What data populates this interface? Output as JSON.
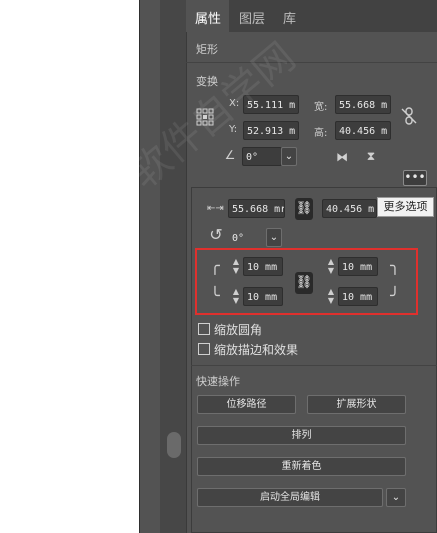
{
  "tabs": [
    {
      "label": "属性"
    },
    {
      "label": "图层"
    },
    {
      "label": "库"
    }
  ],
  "shape_title": "矩形",
  "transform": {
    "section_title": "变换",
    "x_label": "X:",
    "x_value": "55.111 m",
    "y_label": "Y:",
    "y_value": "52.913 m",
    "w_label": "宽:",
    "w_value": "55.668 m",
    "h_label": "高:",
    "h_value": "40.456 m",
    "angle_value": "0°"
  },
  "more_options": {
    "tooltip": "更多选项",
    "width_value": "55.668 mr",
    "height_value": "40.456 m",
    "rotate_value": "0°",
    "corner_tl": "10 mm",
    "corner_tr": "10 mm",
    "corner_bl": "10 mm",
    "corner_br": "10 mm",
    "scale_corners_label": "缩放圆角",
    "scale_strokes_label": "缩放描边和效果"
  },
  "quick_actions": {
    "title": "快速操作",
    "offset_path": "位移路径",
    "expand_shape": "扩展形状",
    "arrange": "排列",
    "recolor": "重新着色",
    "global_edit": "启动全局编辑"
  },
  "watermark_text": "软件自学网",
  "colors": {
    "panel_bg": "#535353",
    "highlight_border": "#e0302d",
    "tooltip_bg": "#f2f2f2"
  }
}
